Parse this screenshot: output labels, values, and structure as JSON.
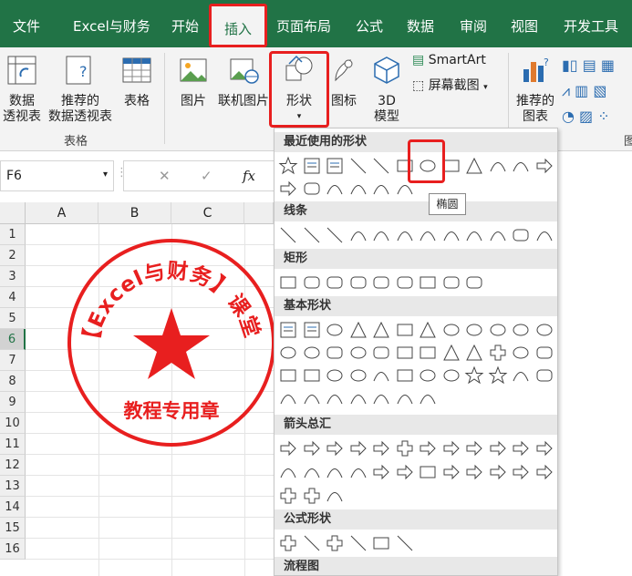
{
  "tabs": [
    "文件",
    "Excel与财务",
    "开始",
    "插入",
    "页面布局",
    "公式",
    "数据",
    "审阅",
    "视图",
    "开发工具"
  ],
  "active_tab": "插入",
  "ribbon": {
    "pivot": "数据\n透视表",
    "recommended_pivot": "推荐的\n数据透视表",
    "table": "表格",
    "group_tables": "表格",
    "picture": "图片",
    "online_picture": "联机图片",
    "shapes": "形状",
    "icons": "图标",
    "model3d": "3D\n模型",
    "smartart": "SmartArt",
    "screenshot": "屏幕截图",
    "recommended_charts": "推荐的\n图表",
    "group_partial": "图"
  },
  "formula_bar": {
    "name_box": "F6",
    "cancel": "✕",
    "enter": "✓",
    "fx": "fx"
  },
  "grid": {
    "columns": [
      "A",
      "B",
      "C"
    ],
    "rows": [
      "1",
      "2",
      "3",
      "4",
      "5",
      "6",
      "7",
      "8",
      "9",
      "10",
      "11",
      "12",
      "13",
      "14",
      "15",
      "16"
    ],
    "selected_row": "6"
  },
  "stamp": {
    "ring_text": "【Excel与财务】课堂",
    "bottom_text": "教程专用章",
    "color": "#e81f1f"
  },
  "dropdown": {
    "sections": [
      "最近使用的形状",
      "线条",
      "矩形",
      "基本形状",
      "箭头总汇",
      "公式形状",
      "流程图"
    ],
    "tooltip": "椭圆"
  }
}
